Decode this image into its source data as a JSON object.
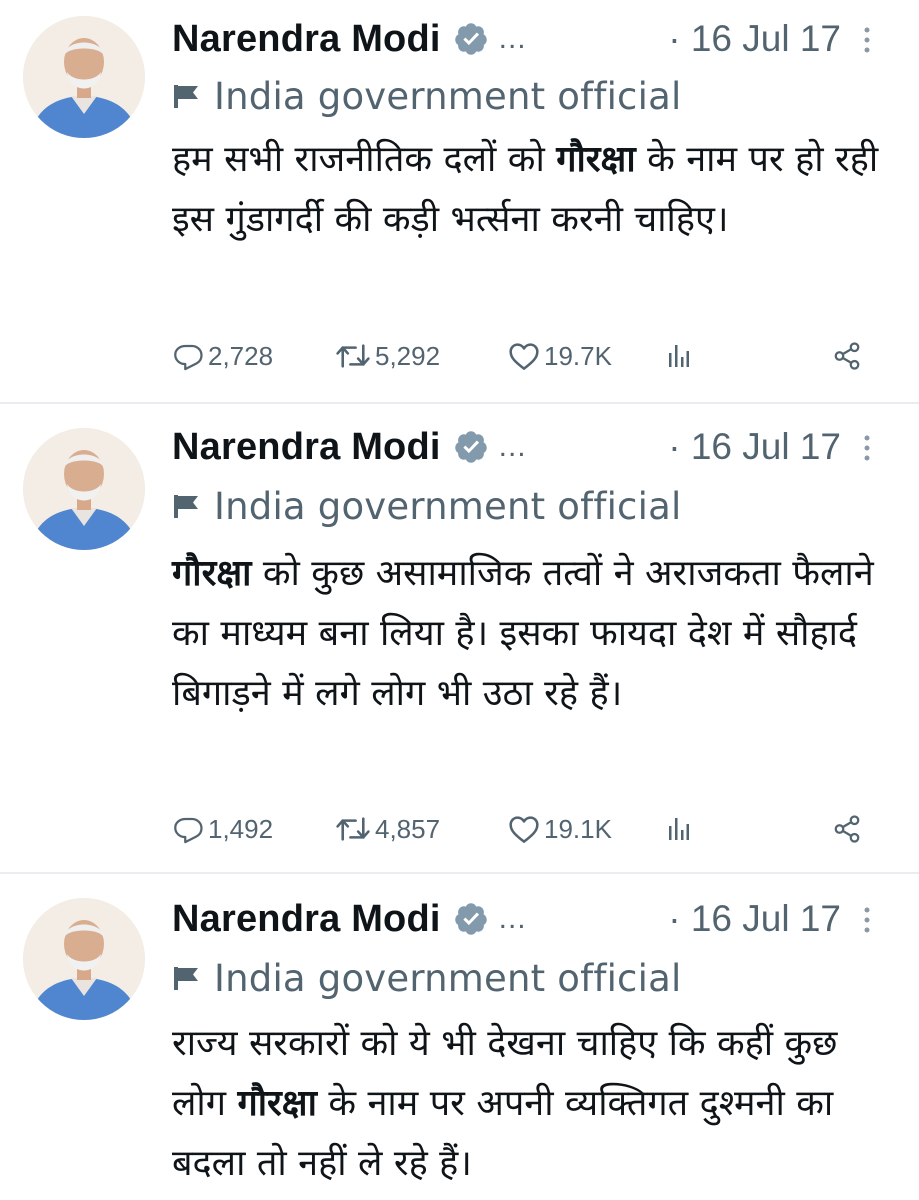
{
  "tweets": [
    {
      "name": "Narendra Modi",
      "ellipsis": "...",
      "date": "· 16 Jul 17",
      "label": "India government official",
      "text_parts": [
        {
          "t": "हम सभी राजनीतिक दलों को "
        },
        {
          "t": "गौरक्षा",
          "b": true
        },
        {
          "t": " के नाम पर हो रही इस गुंडागर्दी की कड़ी भर्त्सना करनी चाहिए।"
        }
      ],
      "replies": "2,728",
      "reposts": "5,292",
      "likes": "19.7K"
    },
    {
      "name": "Narendra Modi",
      "ellipsis": "...",
      "date": "· 16 Jul 17",
      "label": "India government official",
      "text_parts": [
        {
          "t": "गौरक्षा",
          "b": true
        },
        {
          "t": " को कुछ असामाजिक तत्वों ने अराजकता फैलाने का माध्यम बना लिया है। इसका फायदा देश में सौहार्द बिगाड़ने में लगे लोग भी उठा रहे हैं।"
        }
      ],
      "replies": "1,492",
      "reposts": "4,857",
      "likes": "19.1K"
    },
    {
      "name": "Narendra Modi",
      "ellipsis": "...",
      "date": "· 16 Jul 17",
      "label": "India government official",
      "text_parts": [
        {
          "t": "राज्य सरकारों को ये भी देखना चाहिए कि कहीं कुछ लोग "
        },
        {
          "t": "गौरक्षा",
          "b": true
        },
        {
          "t": " के नाम पर अपनी व्यक्तिगत दुश्मनी का बदला तो नहीं ले रहे हैं।"
        }
      ]
    }
  ],
  "icons": {
    "verified": "verified-badge-icon",
    "flag": "government-flag-icon",
    "reply": "reply-icon",
    "repost": "repost-icon",
    "like": "like-icon",
    "views": "views-icon",
    "share": "share-icon",
    "more": "more-options-icon"
  },
  "colors": {
    "text": "#0f1419",
    "muted": "#536471",
    "verified_badge": "#829aab",
    "separator": "#e9edf0"
  }
}
